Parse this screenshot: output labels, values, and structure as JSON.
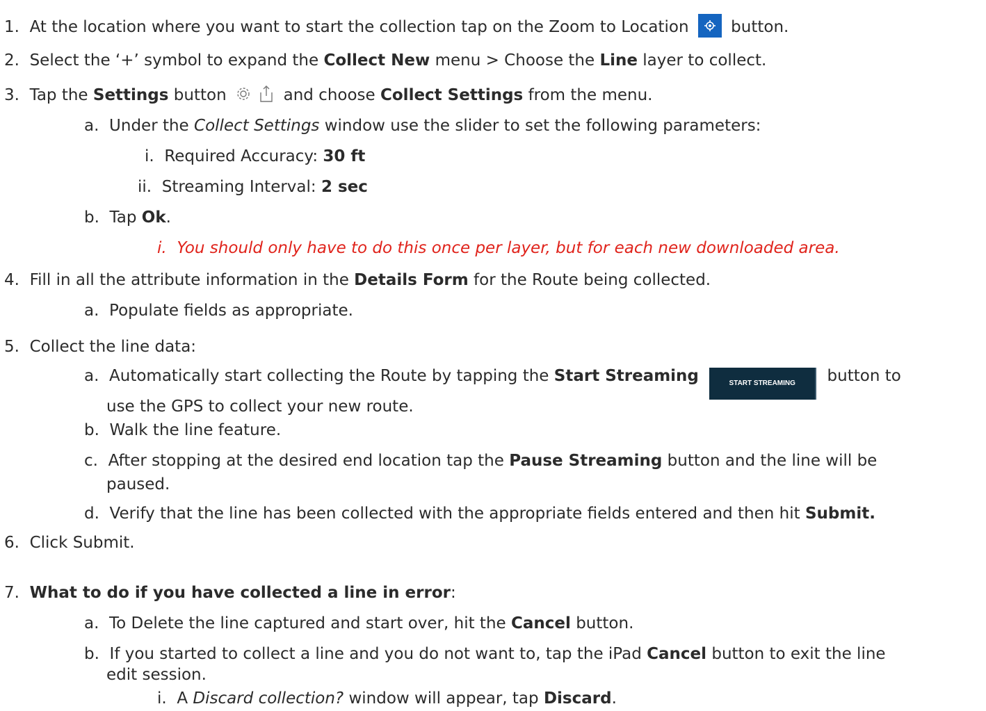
{
  "steps": [
    {
      "n": "1.",
      "parts": [
        "At the location where you want to start the collection tap on the Zoom to Location",
        "button."
      ]
    },
    {
      "n": "2.",
      "parts": [
        "Select the ‘+’ symbol to expand the",
        "Collect New",
        "menu > Choose the",
        "Line",
        "layer to collect."
      ]
    },
    {
      "n": "3.",
      "parts": [
        "Tap the",
        "Settings",
        "button",
        "and choose",
        "Collect Settings",
        "from the menu."
      ]
    },
    {
      "n": "a.",
      "parts": [
        "Under the",
        "Collect Settings",
        "window use the slider to set the following parameters:"
      ]
    },
    {
      "n": "i.",
      "parts": [
        "Required Accuracy:",
        "30 ft"
      ]
    },
    {
      "n": "ii.",
      "parts": [
        "Streaming Interval:",
        "2 sec"
      ]
    },
    {
      "n": "b.",
      "parts": [
        "Tap",
        "Ok",
        "."
      ]
    },
    {
      "n": "i.",
      "parts": [
        "You should only have to do this once per layer, but for each new downloaded area."
      ]
    },
    {
      "n": "4.",
      "parts": [
        "Fill in all the attribute information in the",
        "Details Form",
        "for the Route being collected."
      ]
    },
    {
      "n": "a.",
      "parts": [
        "Populate fields as appropriate."
      ]
    },
    {
      "n": "5.",
      "parts": [
        "Collect the line data:"
      ]
    },
    {
      "n": "a.",
      "parts": [
        "Automatically start collecting the Route by tapping the",
        "Start Streaming",
        "START STREAMING",
        "button to",
        "use the GPS to collect your new route."
      ]
    },
    {
      "n": "b.",
      "parts": [
        "Walk the line feature."
      ]
    },
    {
      "n": "c.",
      "parts": [
        "After stopping at the desired end location tap the",
        "Pause Streaming",
        "button and the line will be",
        "paused."
      ]
    },
    {
      "n": "d.",
      "parts": [
        "Verify that the line has been collected with the appropriate fields entered and then hit",
        "Submit."
      ]
    },
    {
      "n": "6.",
      "parts": [
        "Click Submit."
      ]
    },
    {
      "n": "7.",
      "parts": [
        "What to do if you have collected a line in error",
        ":"
      ]
    },
    {
      "n": "a.",
      "parts": [
        "To Delete the line captured and start over, hit the",
        "Cancel",
        "button."
      ]
    },
    {
      "n": "b.",
      "parts": [
        "If you started to collect a line and you do not want to, tap the iPad",
        "Cancel",
        "button to exit the line",
        "edit session."
      ]
    },
    {
      "n": "i.",
      "parts": [
        "A",
        "Discard collection?",
        "window will appear, tap",
        "Discard",
        "."
      ]
    }
  ],
  "icons": {
    "zoom_to_location": "crosshair-location-icon",
    "settings": "gear-icon",
    "share": "share-icon"
  },
  "colors": {
    "note_red": "#e0241c",
    "location_button": "#1565c0",
    "streaming_button": "#0f2d3f"
  }
}
